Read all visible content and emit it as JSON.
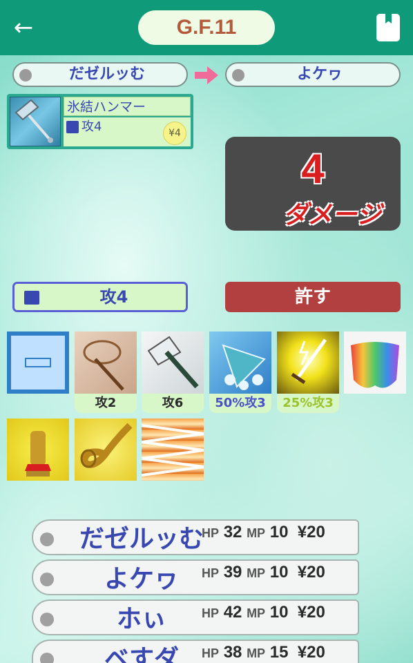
{
  "header": {
    "title": "G.F.11"
  },
  "turn": {
    "attacker": "だゼルッむ",
    "target": "よケヮ"
  },
  "item": {
    "name": "氷結ハンマー",
    "effect": "攻4",
    "price": "¥4"
  },
  "damage": {
    "value": "4",
    "label": "ダメージ"
  },
  "actions": {
    "attack_label": "攻4",
    "forgive_label": "許す"
  },
  "cards": [
    {
      "name": "empty-slot",
      "label": ""
    },
    {
      "name": "whip",
      "label": "攻2"
    },
    {
      "name": "axe",
      "label": "攻6"
    },
    {
      "name": "ice-fan",
      "label": "50%攻3"
    },
    {
      "name": "lightning-sword",
      "label": "25%攻3"
    },
    {
      "name": "rainbow-cloak",
      "label": ""
    },
    {
      "name": "golden-statue",
      "label": ""
    },
    {
      "name": "golden-horn",
      "label": ""
    },
    {
      "name": "fire-zigzag",
      "label": ""
    }
  ],
  "players": [
    {
      "name": "だゼルッむ",
      "hp": "32",
      "mp": "10",
      "money": "20"
    },
    {
      "name": "よケヮ",
      "hp": "39",
      "mp": "10",
      "money": "20"
    },
    {
      "name": "ホぃ",
      "hp": "42",
      "mp": "10",
      "money": "20"
    },
    {
      "name": "ベすダ",
      "hp": "38",
      "mp": "15",
      "money": "20"
    }
  ],
  "labels": {
    "hp": "HP",
    "mp": "MP",
    "yen": "¥"
  },
  "colors": {
    "header": "#0f9a79",
    "title_text": "#b35a3a",
    "player_text": "#3848b0",
    "damage_text": "#d81e1e",
    "forgive_bg": "#b34040",
    "label_50": "#4a50c8",
    "label_25": "#9ac22a"
  }
}
